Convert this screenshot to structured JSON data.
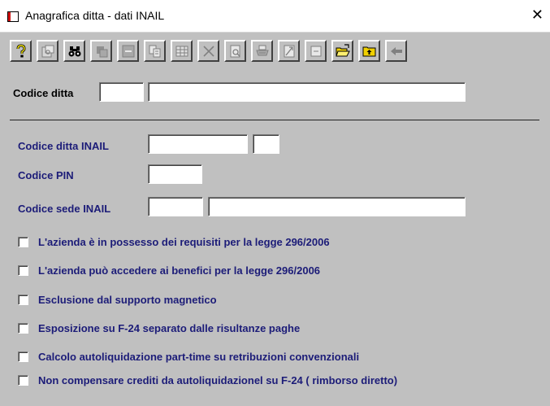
{
  "window": {
    "title": "Anagrafica ditta - dati INAIL",
    "close_glyph": "✕"
  },
  "toolbar": {
    "buttons": [
      {
        "name": "help",
        "icon": "question-mark-icon"
      },
      {
        "name": "properties",
        "icon": "properties-icon"
      },
      {
        "name": "search",
        "icon": "binoculars-icon"
      },
      {
        "name": "copy-record",
        "icon": "copy-record-icon"
      },
      {
        "name": "delete",
        "icon": "minus-icon"
      },
      {
        "name": "duplicate",
        "icon": "duplicate-icon"
      },
      {
        "name": "table",
        "icon": "table-icon"
      },
      {
        "name": "cancel",
        "icon": "cross-icon"
      },
      {
        "name": "preview",
        "icon": "print-preview-icon"
      },
      {
        "name": "print",
        "icon": "printer-icon"
      },
      {
        "name": "export",
        "icon": "export-icon"
      },
      {
        "name": "notes",
        "icon": "notes-icon"
      },
      {
        "name": "open",
        "icon": "folder-open-icon"
      },
      {
        "name": "folder-up",
        "icon": "folder-up-icon"
      },
      {
        "name": "back",
        "icon": "arrow-left-icon"
      }
    ]
  },
  "form": {
    "codice_ditta": {
      "label": "Codice ditta",
      "code": "",
      "description": ""
    },
    "codice_ditta_inail": {
      "label": "Codice ditta INAIL",
      "value": "",
      "suffix": ""
    },
    "codice_pin": {
      "label": "Codice PIN",
      "value": ""
    },
    "codice_sede_inail": {
      "label": "Codice sede INAIL",
      "code": "",
      "description": ""
    },
    "checkboxes": [
      {
        "label": "L'azienda è in possesso dei requisiti per la legge 296/2006",
        "checked": false
      },
      {
        "label": "L'azienda può accedere ai benefici per la legge 296/2006",
        "checked": false
      },
      {
        "label": "Esclusione dal supporto magnetico",
        "checked": false
      },
      {
        "label": "Esposizione su F-24 separato dalle risultanze paghe",
        "checked": false
      },
      {
        "label": "Calcolo autoliquidazione part-time su retribuzioni convenzionali",
        "checked": false
      },
      {
        "label": "Non compensare crediti da autoliquidazionel su F-24 ( rimborso diretto)",
        "checked": false
      }
    ]
  },
  "colors": {
    "background": "#c0c0c0",
    "label_blue": "#1c1c78",
    "label_black": "#000000"
  }
}
